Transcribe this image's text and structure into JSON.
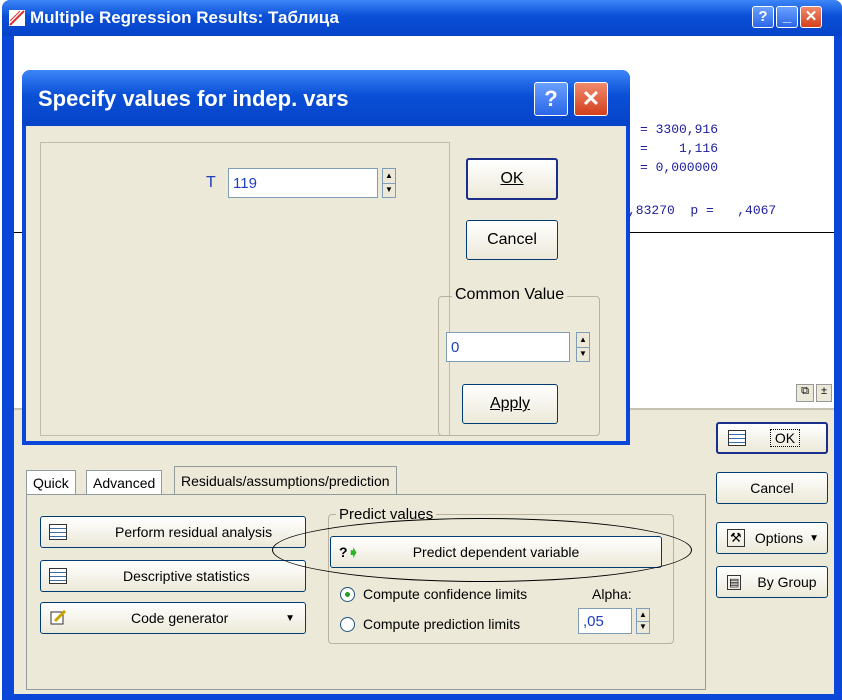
{
  "window": {
    "title": "Multiple Regression Results: Таблица",
    "help_btn": "?",
    "min_btn": "_",
    "close_btn": "✕"
  },
  "results": {
    "line1": "= 3300,916",
    "line2": "=    1,116",
    "line3": "= 0,000000",
    "line4": ",83270  p =   ,4067"
  },
  "dialog": {
    "title": "Specify values for indep. vars",
    "help_btn": "?",
    "close_btn": "✕",
    "var_label": "T",
    "var_value": "119",
    "ok_label": "OK",
    "cancel_label": "Cancel",
    "common_value_label": "Common Value",
    "common_value": "0",
    "apply_label": "Apply"
  },
  "side": {
    "ok_label": "OK",
    "cancel_label": "Cancel",
    "options_label": "Options",
    "bygroup_label": "By Group"
  },
  "tabs": [
    {
      "label": "Quick"
    },
    {
      "label": "Advanced"
    },
    {
      "label": "Residuals/assumptions/prediction"
    }
  ],
  "panel": {
    "perform_residual": "Perform residual analysis",
    "descriptive_stats": "Descriptive statistics",
    "code_generator": "Code generator",
    "predict_group": "Predict values",
    "predict_dependent": "Predict dependent variable",
    "compute_confidence": "Compute confidence limits",
    "compute_prediction": "Compute prediction limits",
    "alpha_label": "Alpha:",
    "alpha_value": ",05"
  },
  "colors": {
    "title_blue": "#0a46d8",
    "panel": "#ece9d8",
    "mono_text": "#1d1d9e",
    "input_text": "#1d3fbf"
  },
  "icons": [
    "help-icon",
    "minimize-icon",
    "close-icon",
    "spin-up-icon",
    "spin-down-icon",
    "table-icon",
    "pencil-icon",
    "options-icon",
    "bygroup-icon",
    "predict-arrow-icon"
  ]
}
